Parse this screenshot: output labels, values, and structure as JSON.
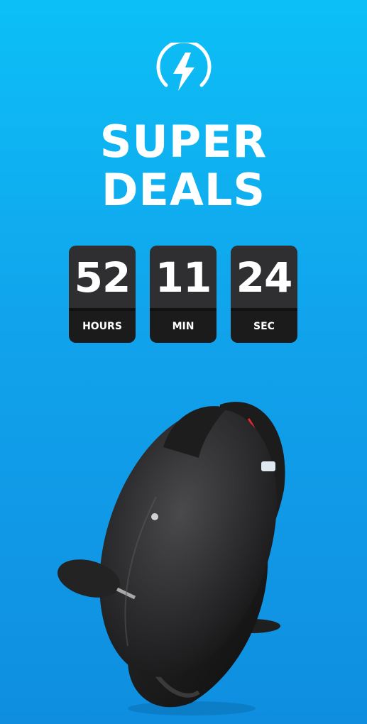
{
  "promo": {
    "title_line1": "SUPER",
    "title_line2": "DEALS",
    "icon": "lightning-power-icon"
  },
  "countdown": {
    "hours_value": "52",
    "hours_label": "HOURS",
    "minutes_value": "11",
    "minutes_label": "MIN",
    "seconds_value": "24",
    "seconds_label": "SEC"
  },
  "product": {
    "image": "electric-unicycle-image"
  },
  "colors": {
    "background_top": "#0cc0f6",
    "background_bottom": "#0f8ee0",
    "timer_top": "#2f2f31",
    "timer_bottom": "#1b1b1c",
    "text": "#ffffff",
    "accent_red": "#e0262c"
  }
}
